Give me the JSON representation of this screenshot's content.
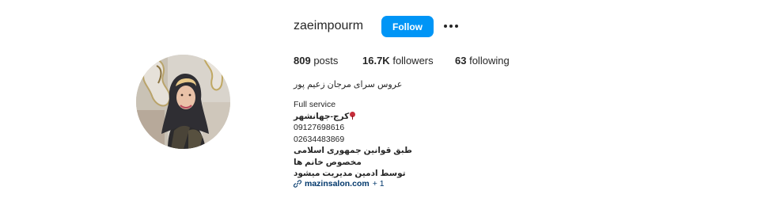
{
  "profile": {
    "username": "zaeimpourm",
    "follow_label": "Follow",
    "more_label": "More options",
    "full_name": "عروس سرای مرجان زعیم پور"
  },
  "stats": {
    "posts": {
      "count": "809",
      "label": "posts"
    },
    "followers": {
      "count": "16.7K",
      "label": "followers"
    },
    "following": {
      "count": "63",
      "label": "following"
    }
  },
  "bio": {
    "line1": "Full service",
    "line2": "کرج-جهانشهر",
    "line3": "09127698616",
    "line4": "02634483869",
    "line5": "طبق قوانین جمهوری اسلامی",
    "line6": "مخصوص خانم ها",
    "line7": "توسط ادمین مدیریت میشود"
  },
  "link": {
    "text": "mazinsalon.com",
    "extra": "+ 1"
  },
  "icons": {
    "more": "more-horizontal-icon",
    "pin": "location-pin-icon",
    "link": "link-icon"
  },
  "colors": {
    "follow_button": "#0095f6",
    "link": "#00376b",
    "text": "#262626"
  }
}
